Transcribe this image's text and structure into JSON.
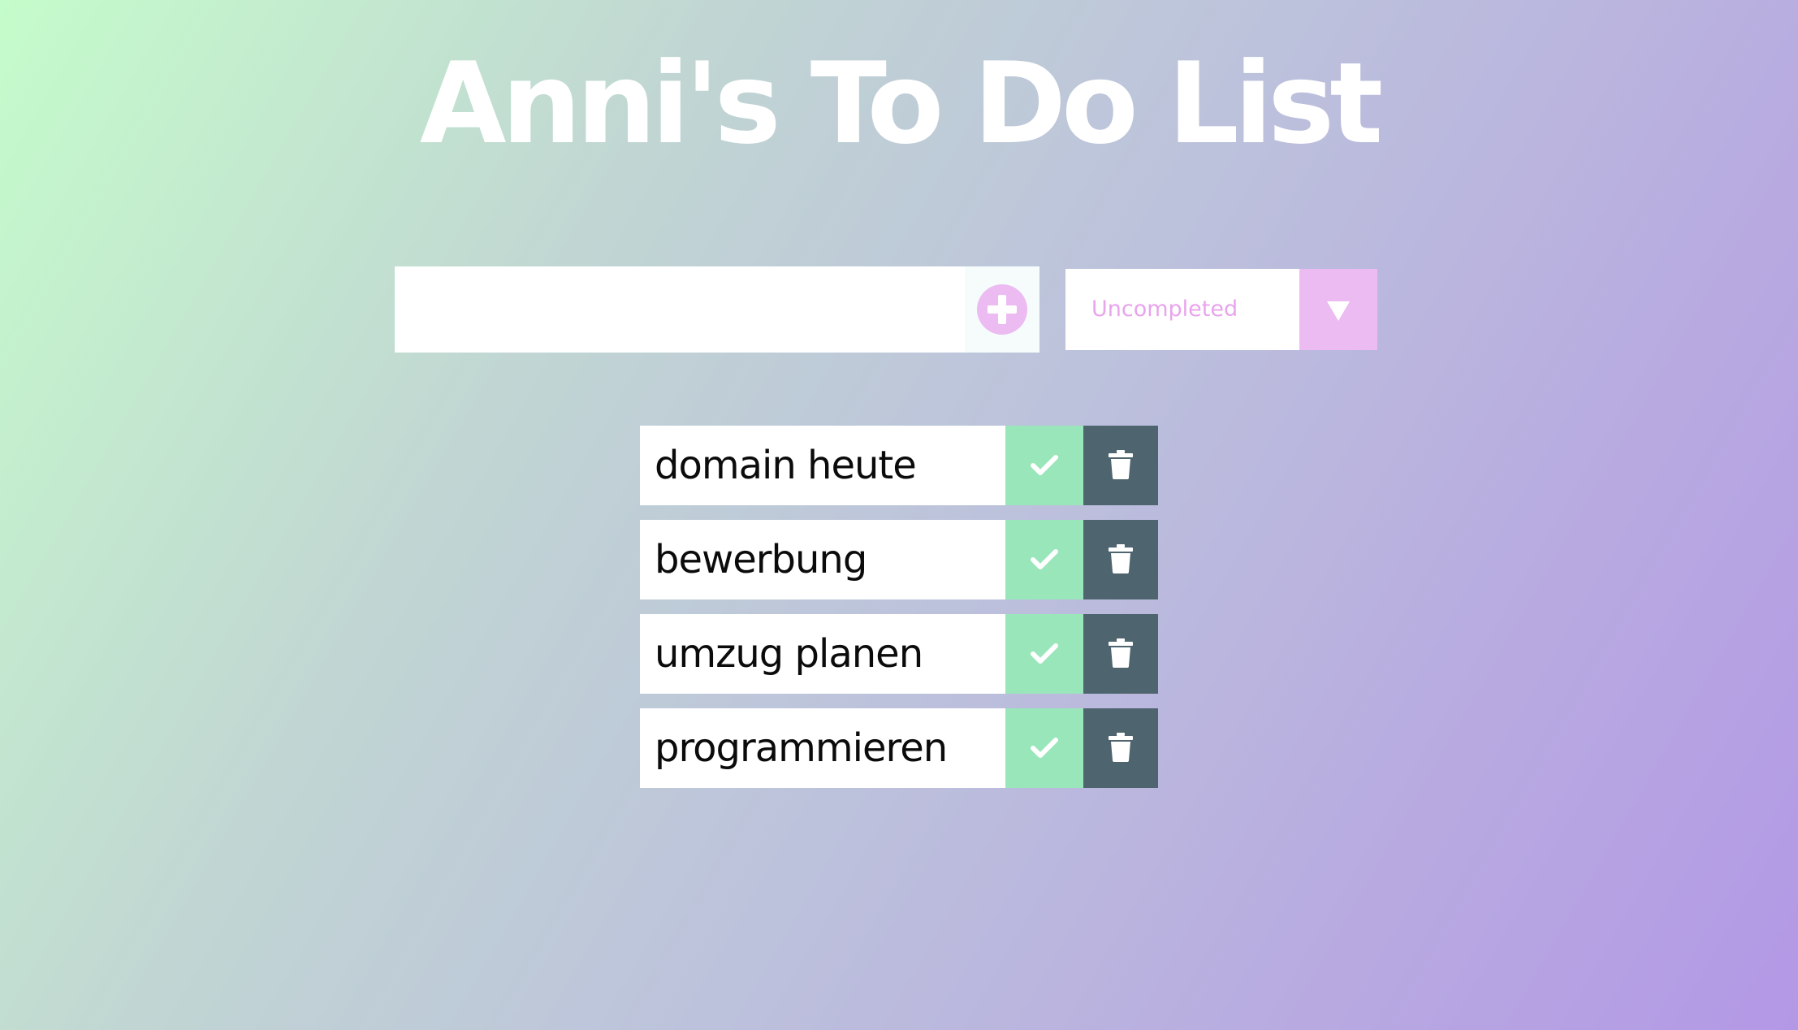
{
  "header": {
    "title": "Anni's To Do List"
  },
  "form": {
    "input_value": "",
    "input_placeholder": "",
    "add_icon": "plus-circle-icon",
    "filter_selected": "Uncompleted",
    "filter_icon": "caret-down-icon"
  },
  "todos": [
    {
      "text": "domain heute"
    },
    {
      "text": "bewerbung"
    },
    {
      "text": "umzug planen"
    },
    {
      "text": "programmieren"
    }
  ],
  "icons": {
    "complete": "check-icon",
    "delete": "trash-icon"
  },
  "colors": {
    "accent_pink": "#ebbbf1",
    "filter_text": "#e8a4ec",
    "complete_green": "#99e6ba",
    "delete_slate": "#4e656f",
    "gradient_start": "#c5fccb",
    "gradient_end": "#b398e6"
  }
}
